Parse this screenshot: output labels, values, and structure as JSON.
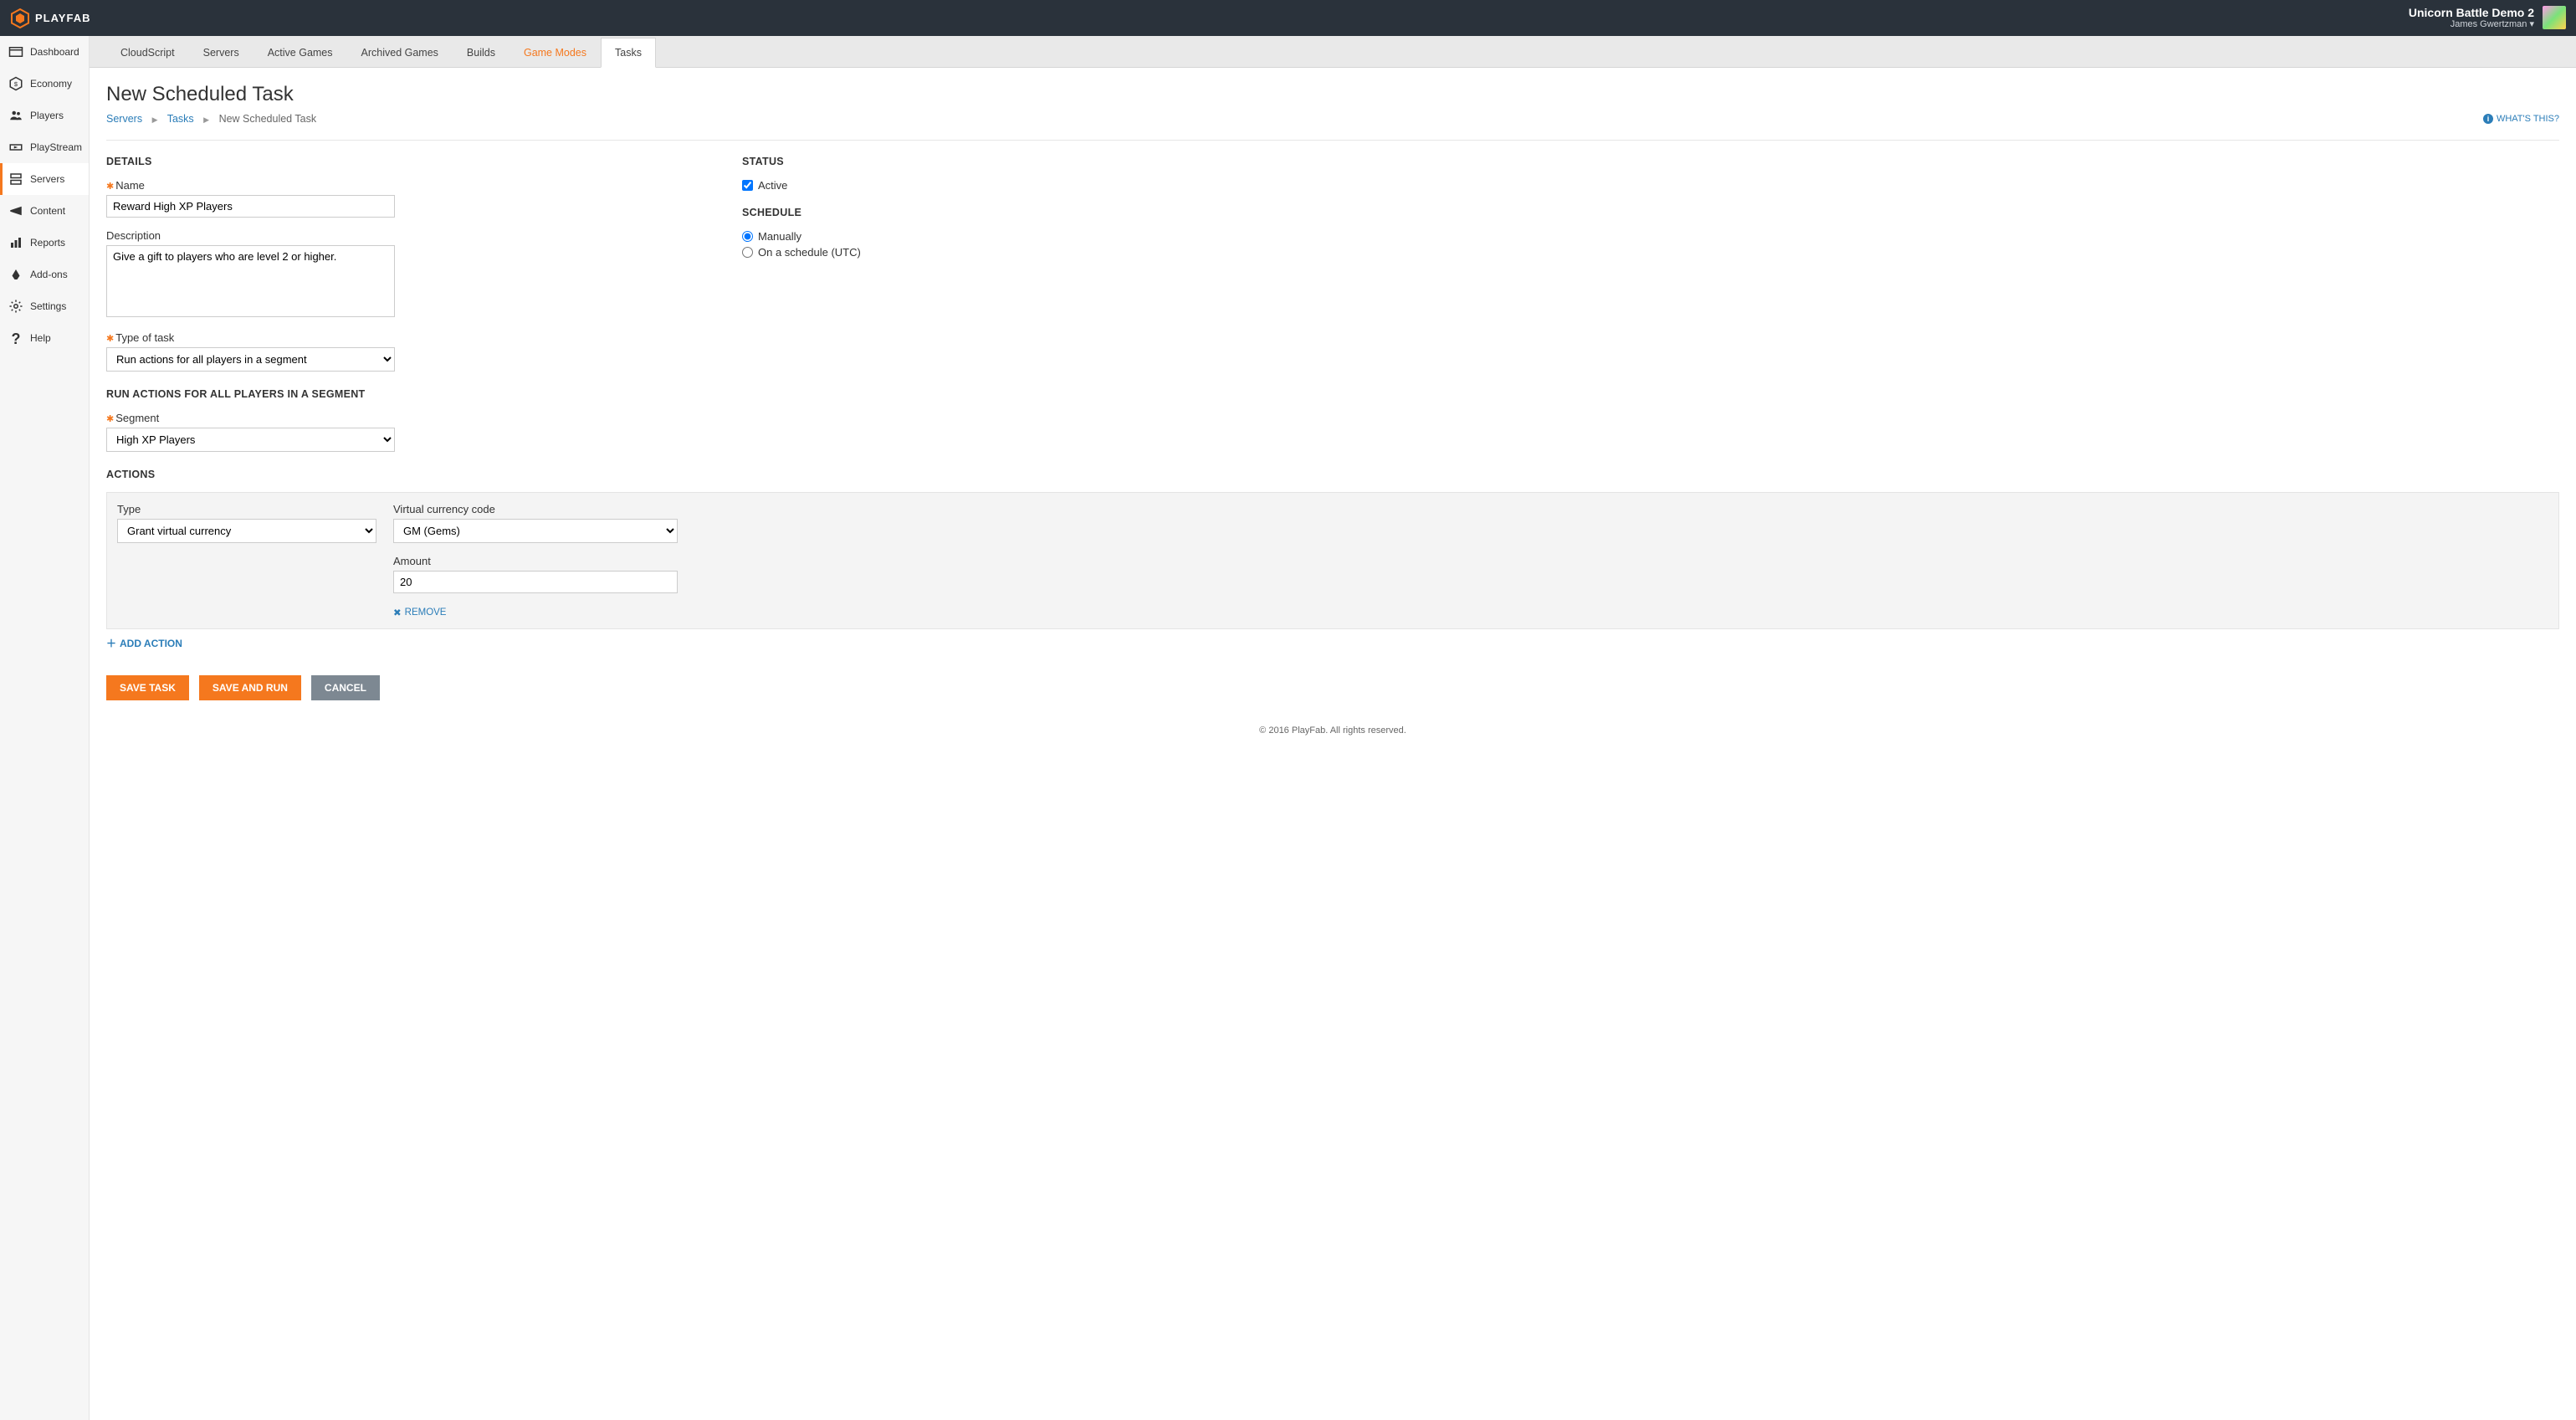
{
  "brand": "PLAYFAB",
  "header": {
    "title_name": "Unicorn Battle Demo 2",
    "user_name": "James Gwertzman"
  },
  "sidebar": {
    "items": [
      {
        "label": "Dashboard"
      },
      {
        "label": "Economy"
      },
      {
        "label": "Players"
      },
      {
        "label": "PlayStream"
      },
      {
        "label": "Servers"
      },
      {
        "label": "Content"
      },
      {
        "label": "Reports"
      },
      {
        "label": "Add-ons"
      },
      {
        "label": "Settings"
      },
      {
        "label": "Help"
      }
    ]
  },
  "tabs": [
    {
      "label": "CloudScript"
    },
    {
      "label": "Servers"
    },
    {
      "label": "Active Games"
    },
    {
      "label": "Archived Games"
    },
    {
      "label": "Builds"
    },
    {
      "label": "Game Modes"
    },
    {
      "label": "Tasks"
    }
  ],
  "page": {
    "title": "New Scheduled Task",
    "breadcrumb": [
      "Servers",
      "Tasks",
      "New Scheduled Task"
    ],
    "whats_this": "WHAT'S THIS?"
  },
  "details": {
    "heading": "DETAILS",
    "name_label": "Name",
    "name_value": "Reward High XP Players",
    "desc_label": "Description",
    "desc_value": "Give a gift to players who are level 2 or higher.",
    "type_label": "Type of task",
    "type_value": "Run actions for all players in a segment",
    "segment_heading": "RUN ACTIONS FOR ALL PLAYERS IN A SEGMENT",
    "segment_label": "Segment",
    "segment_value": "High XP Players"
  },
  "status": {
    "heading": "STATUS",
    "active_label": "Active",
    "schedule_heading": "SCHEDULE",
    "manual_label": "Manually",
    "sched_label": "On a schedule (UTC)"
  },
  "actions": {
    "heading": "ACTIONS",
    "type_label": "Type",
    "type_value": "Grant virtual currency",
    "vcc_label": "Virtual currency code",
    "vcc_value": "GM (Gems)",
    "amount_label": "Amount",
    "amount_value": "20",
    "remove_label": "REMOVE",
    "add_label": "ADD ACTION"
  },
  "buttons": {
    "save": "SAVE TASK",
    "save_run": "SAVE AND RUN",
    "cancel": "CANCEL"
  },
  "footer": "© 2016 PlayFab. All rights reserved."
}
